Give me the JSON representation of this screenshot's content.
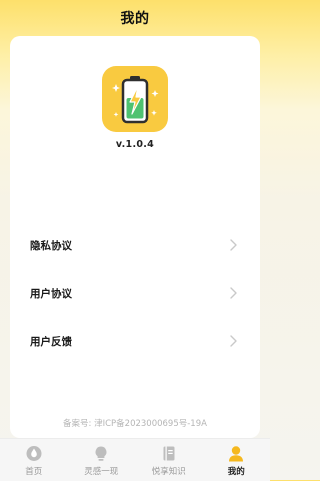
{
  "header": {
    "title": "我的"
  },
  "app": {
    "icon": "battery-charging-icon",
    "version": "v.1.0.4"
  },
  "menu": [
    {
      "label": "隐私协议",
      "icon": "chevron-right-icon"
    },
    {
      "label": "用户协议",
      "icon": "chevron-right-icon"
    },
    {
      "label": "用户反馈",
      "icon": "chevron-right-icon"
    }
  ],
  "footer": {
    "icp": "备案号: 津ICP备2023000695号-19A"
  },
  "tabs": [
    {
      "label": "首页",
      "icon": "home-drop-icon"
    },
    {
      "label": "灵感一现",
      "icon": "lightbulb-icon"
    },
    {
      "label": "悦享知识",
      "icon": "book-icon"
    },
    {
      "label": "我的",
      "icon": "user-icon"
    }
  ],
  "colors": {
    "accent": "#F9CA40",
    "battery_green": "#4FC270",
    "inactive": "#BDBDBD",
    "active": "#F5B81E"
  }
}
